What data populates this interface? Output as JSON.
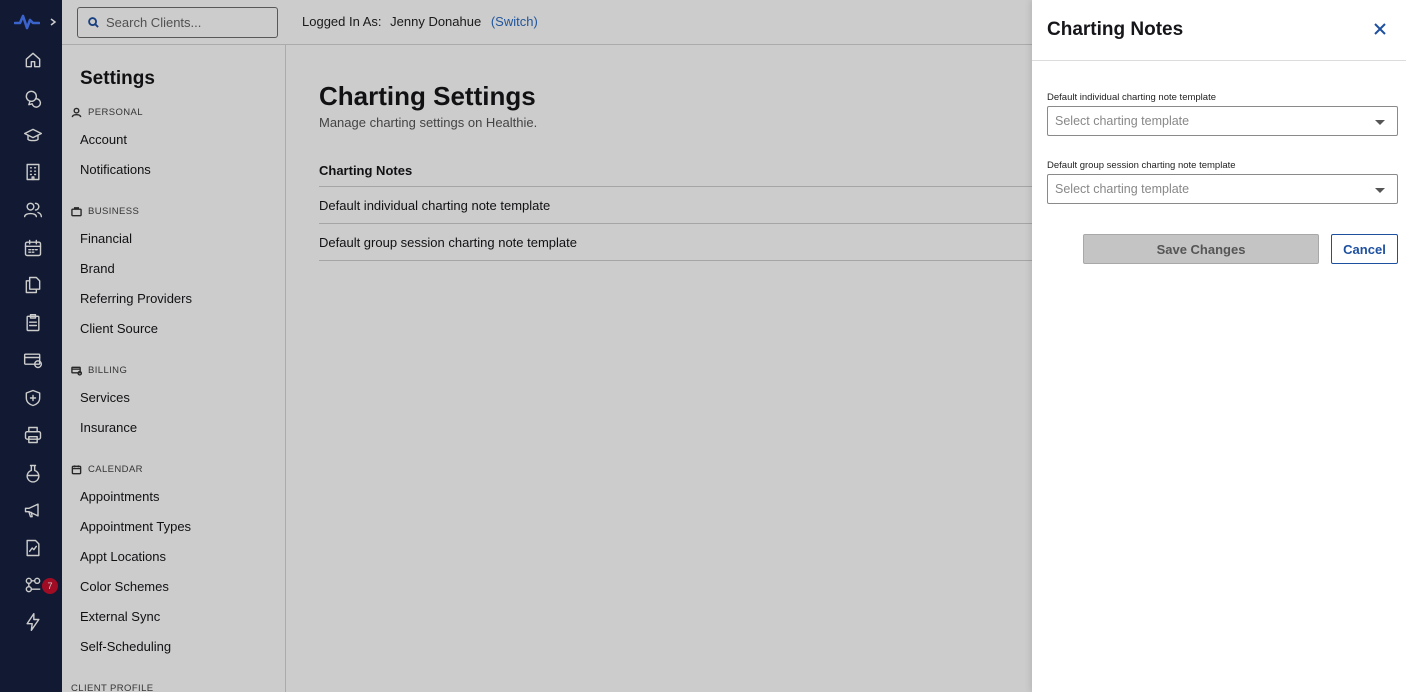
{
  "topbar": {
    "search_placeholder": "Search Clients...",
    "logged_in_label": "Logged In As:",
    "user_name": "Jenny Donahue",
    "switch_label": "(Switch)"
  },
  "rail": {
    "badge_count": "7",
    "icons": [
      "home-icon",
      "chat-icon",
      "education-icon",
      "building-icon",
      "clients-icon",
      "calendar-icon",
      "documents-icon",
      "clipboard-icon",
      "billing-icon",
      "shield-icon",
      "printer-icon",
      "lab-icon",
      "megaphone-icon",
      "chart-icon",
      "integrations-icon",
      "lightning-icon"
    ]
  },
  "sidebar": {
    "title": "Settings",
    "sections": [
      {
        "label": "PERSONAL",
        "icon": "person-icon",
        "items": [
          "Account",
          "Notifications"
        ]
      },
      {
        "label": "BUSINESS",
        "icon": "briefcase-icon",
        "items": [
          "Financial",
          "Brand",
          "Referring Providers",
          "Client Source"
        ]
      },
      {
        "label": "BILLING",
        "icon": "billing-icon",
        "items": [
          "Services",
          "Insurance"
        ]
      },
      {
        "label": "CALENDAR",
        "icon": "calendar-icon",
        "items": [
          "Appointments",
          "Appointment Types",
          "Appt Locations",
          "Color Schemes",
          "External Sync",
          "Self-Scheduling"
        ]
      },
      {
        "label": "CLIENT PROFILE",
        "icon": "",
        "items": []
      }
    ]
  },
  "main": {
    "title": "Charting Settings",
    "subtitle": "Manage charting settings on Healthie.",
    "section_title": "Charting Notes",
    "rows": [
      "Default individual charting note template",
      "Default group session charting note template"
    ]
  },
  "drawer": {
    "title": "Charting Notes",
    "fields": [
      {
        "label": "Default individual charting note template",
        "placeholder": "Select charting template"
      },
      {
        "label": "Default group session charting note template",
        "placeholder": "Select charting template"
      }
    ],
    "save_label": "Save Changes",
    "cancel_label": "Cancel"
  },
  "colors": {
    "rail_bg": "#16213f",
    "accent": "#1e50a0",
    "badge": "#c8102e"
  }
}
